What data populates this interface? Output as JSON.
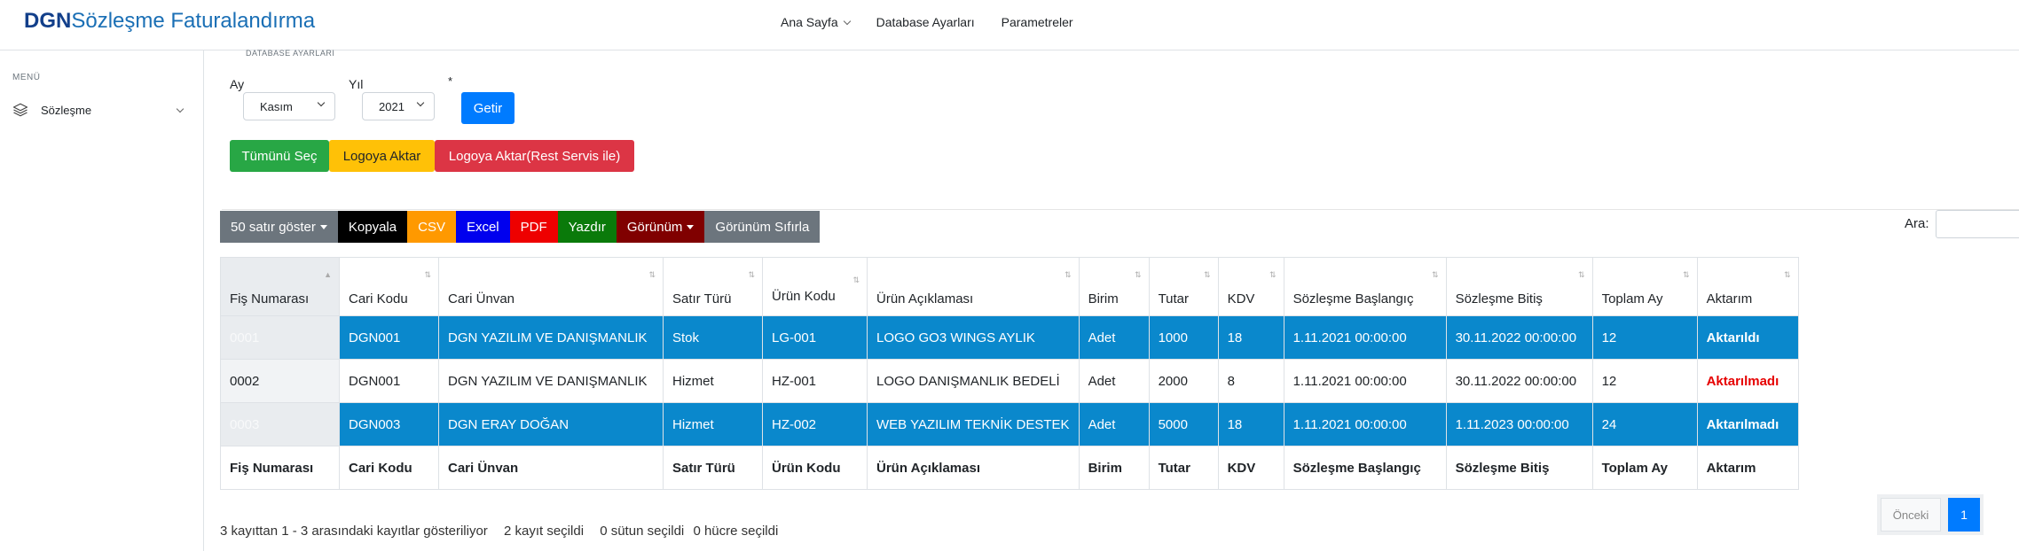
{
  "brand": {
    "bold": "DGN",
    "rest": "Sözleşme Faturalandırma"
  },
  "topnav": {
    "home": "Ana Sayfa",
    "db": "Database Ayarları",
    "params": "Parametreler"
  },
  "sidebar": {
    "menu_title": "MENÜ",
    "item_label": "Sözleşme"
  },
  "form": {
    "legend": "DATABASE AYARLARI",
    "month_label": "Ay",
    "month_value": "Kasım",
    "year_label": "Yıl",
    "year_value": "2021",
    "asterisk": "*",
    "fetch_button": "Getir",
    "select_all_button": "Tümünü Seç",
    "transfer_button": "Logoya Aktar",
    "transfer_rest_button": "Logoya Aktar(Rest Servis ile)"
  },
  "dt_buttons": {
    "show_rows": "50 satır göster",
    "copy": "Kopyala",
    "csv": "CSV",
    "excel": "Excel",
    "pdf": "PDF",
    "print": "Yazdır",
    "view": "Görünüm",
    "reset_view": "Görünüm Sıfırla"
  },
  "search": {
    "label": "Ara:"
  },
  "table": {
    "headers": [
      "Fiş Numarası",
      "Cari Kodu",
      "Cari Ünvan",
      "Satır Türü",
      "Ürün Kodu",
      "Ürün Açıklaması",
      "Birim",
      "Tutar",
      "KDV",
      "Sözleşme Başlangıç",
      "Sözleşme Bitiş",
      "Toplam Ay",
      "Aktarım"
    ],
    "rows": [
      [
        "0001",
        "DGN001",
        "DGN YAZILIM VE DANIŞMANLIK",
        "Stok",
        "LG-001",
        "LOGO GO3 WINGS AYLIK",
        "Adet",
        "1000",
        "18",
        "1.11.2021 00:00:00",
        "30.11.2022 00:00:00",
        "12",
        "Aktarıldı"
      ],
      [
        "0002",
        "DGN001",
        "DGN YAZILIM VE DANIŞMANLIK",
        "Hizmet",
        "HZ-001",
        "LOGO DANIŞMANLIK BEDELİ",
        "Adet",
        "2000",
        "8",
        "1.11.2021 00:00:00",
        "30.11.2022 00:00:00",
        "12",
        "Aktarılmadı"
      ],
      [
        "0003",
        "DGN003",
        "DGN ERAY DOĞAN",
        "Hizmet",
        "HZ-002",
        "WEB YAZILIM TEKNİK DESTEK",
        "Adet",
        "5000",
        "18",
        "1.11.2021 00:00:00",
        "1.11.2023 00:00:00",
        "24",
        "Aktarılmadı"
      ]
    ],
    "footer": [
      "Fiş Numarası",
      "Cari Kodu",
      "Cari Ünvan",
      "Satır Türü",
      "Ürün Kodu",
      "Ürün Açıklaması",
      "Birim",
      "Tutar",
      "KDV",
      "Sözleşme Başlangıç",
      "Sözleşme Bitiş",
      "Toplam Ay",
      "Aktarım"
    ]
  },
  "info": {
    "records": "3 kayıttan 1 - 3 arasındaki kayıtlar gösteriliyor",
    "rows_selected": "2 kayıt seçildi",
    "cols_selected": "0 sütun seçildi",
    "cells_selected": "0 hücre seçildi"
  },
  "pager": {
    "prev": "Önceki",
    "page": "1"
  }
}
